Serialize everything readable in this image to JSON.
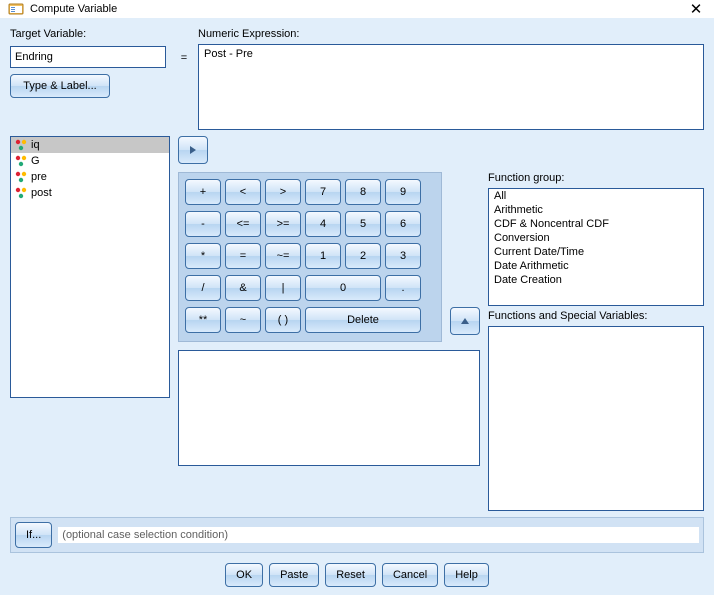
{
  "colors": {
    "accent": "#2a5a99",
    "panel": "#e1eefa",
    "keypad": "#bcd4ed"
  },
  "window": {
    "title": "Compute Variable"
  },
  "labels": {
    "target": "Target Variable:",
    "numeric_expr": "Numeric Expression:",
    "function_group": "Function group:",
    "functions_vars": "Functions and Special Variables:"
  },
  "target": {
    "value": "Endring"
  },
  "eq": "=",
  "type_label_btn": "Type & Label...",
  "expr": {
    "value": "Post - Pre"
  },
  "vars": [
    {
      "name": "iq",
      "selected": true,
      "icon": "nominal"
    },
    {
      "name": "G",
      "selected": false,
      "icon": "nominal"
    },
    {
      "name": "pre",
      "selected": false,
      "icon": "nominal"
    },
    {
      "name": "post",
      "selected": false,
      "icon": "nominal"
    }
  ],
  "keypad": {
    "rows": [
      [
        "+",
        "<",
        ">",
        "7",
        "8",
        "9"
      ],
      [
        "-",
        "<=",
        ">=",
        "4",
        "5",
        "6"
      ],
      [
        "*",
        "=",
        "~=",
        "1",
        "2",
        "3"
      ],
      [
        "/",
        "&",
        "|",
        "0_wide",
        "."
      ],
      [
        "**",
        "~",
        "( )",
        "Delete_wide3"
      ]
    ]
  },
  "function_groups": [
    "All",
    "Arithmetic",
    "CDF & Noncentral CDF",
    "Conversion",
    "Current Date/Time",
    "Date Arithmetic",
    "Date Creation"
  ],
  "if": {
    "button": "If...",
    "text": "(optional case selection condition)"
  },
  "buttons": {
    "ok": "OK",
    "paste": "Paste",
    "reset": "Reset",
    "cancel": "Cancel",
    "help": "Help"
  },
  "icons": {
    "arrow_right": "►",
    "arrow_up": "▲",
    "close": "✕"
  }
}
